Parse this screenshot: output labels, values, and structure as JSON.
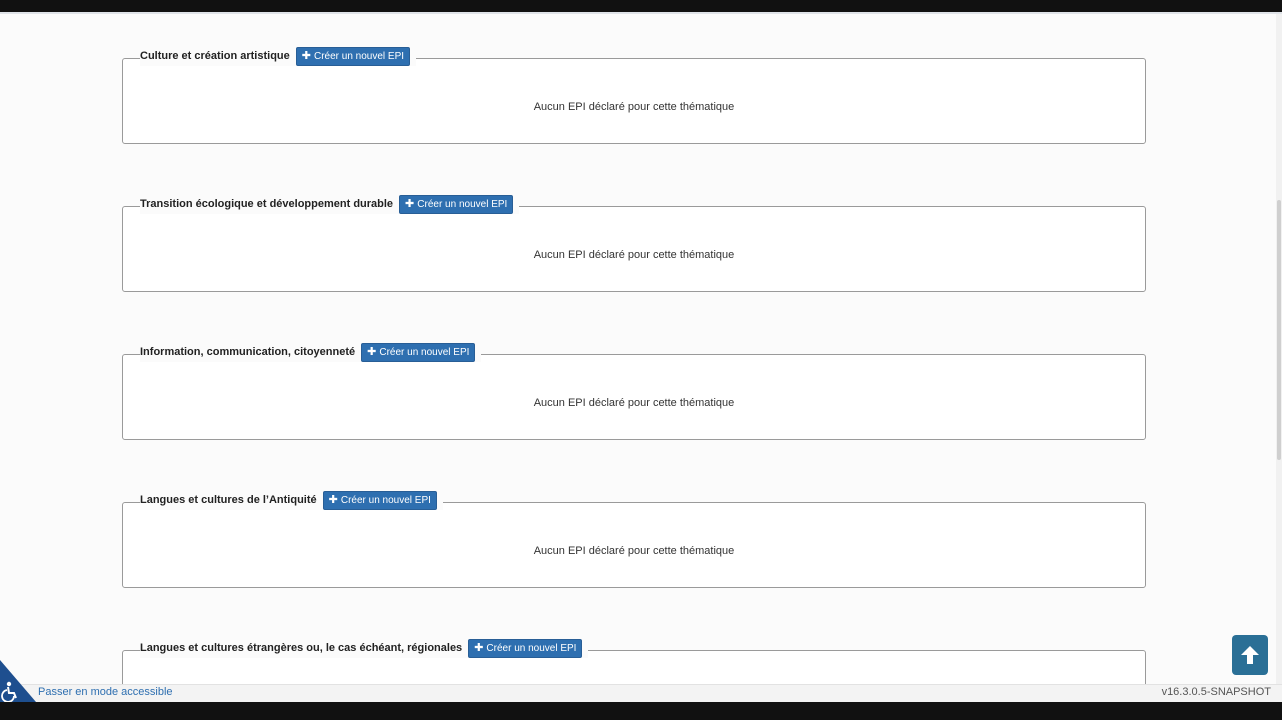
{
  "sections": [
    {
      "title": "Culture et création artistique",
      "button_label": "Créer un nouvel EPI",
      "empty_message": "Aucun EPI déclaré pour cette thématique"
    },
    {
      "title": "Transition écologique et développement durable",
      "button_label": "Créer un nouvel EPI",
      "empty_message": "Aucun EPI déclaré pour cette thématique"
    },
    {
      "title": "Information, communication, citoyenneté",
      "button_label": "Créer un nouvel EPI",
      "empty_message": "Aucun EPI déclaré pour cette thématique"
    },
    {
      "title": "Langues et cultures de l’Antiquité",
      "button_label": "Créer un nouvel EPI",
      "empty_message": "Aucun EPI déclaré pour cette thématique"
    },
    {
      "title": "Langues et cultures étrangères ou, le cas échéant, régionales",
      "button_label": "Créer un nouvel EPI",
      "empty_message": ""
    }
  ],
  "footer": {
    "accessible_mode_label": "Passer en mode accessible",
    "version": "v16.3.0.5-SNAPSHOT"
  },
  "icons": {
    "plus": "plus-icon",
    "accessibility": "wheelchair-icon",
    "back_to_top": "arrow-up-icon"
  },
  "colors": {
    "button_bg": "#2e6fb0",
    "back_top_bg": "#2a6f96",
    "accessibility_bg": "#1e4f8f"
  }
}
